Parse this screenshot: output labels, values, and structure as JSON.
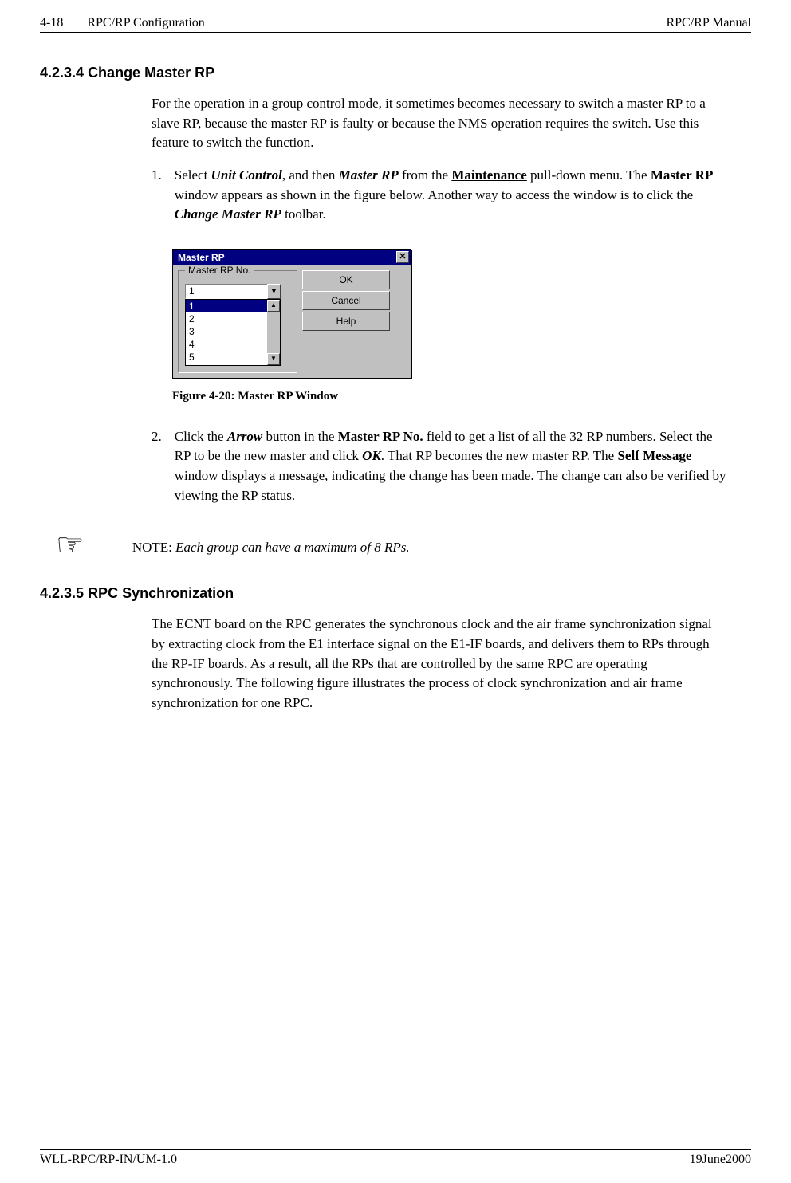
{
  "header": {
    "page_num": "4-18",
    "left_title": "RPC/RP Configuration",
    "right_title": "RPC/RP Manual"
  },
  "section1": {
    "number": "4.2.3.4",
    "title": "Change Master RP",
    "intro": "For the operation in a group control mode, it sometimes becomes necessary to switch a master RP to a slave RP, because the master RP is faulty or because the NMS operation requires the switch.  Use this feature to switch the function.",
    "step1": {
      "num": "1.",
      "p1_a": "Select ",
      "p1_b_ib": "Unit Control",
      "p1_c": ", and then ",
      "p1_d_ib": "Master RP",
      "p1_e": " from the ",
      "p1_f_ub": "Maintenance",
      "p1_g": " pull-down menu.  The ",
      "p1_h_b": "Master RP",
      "p1_i": " window appears as shown in the figure below.  Another way to access the window is to click the ",
      "p1_j_ib": "Change Master RP",
      "p1_k": " toolbar."
    },
    "step2": {
      "num": "2.",
      "p1_a": "Click the ",
      "p1_b_ib": "Arrow",
      "p1_c": " button in the ",
      "p1_d_b": "Master RP No.",
      "p1_e": " field to get a list of all the 32 RP numbers.  Select the RP to be the new master and click ",
      "p1_f_ib": "OK",
      "p1_g": ".  That RP becomes the new master RP.  The ",
      "p1_h_b": "Self Message",
      "p1_i": " window displays a message, indicating the change has been made.  The change can also be verified by viewing the RP status."
    }
  },
  "dialog": {
    "title": "Master RP",
    "group_label": "Master RP No.",
    "selected": "1",
    "items": [
      "1",
      "2",
      "3",
      "4",
      "5"
    ],
    "buttons": {
      "ok": "OK",
      "cancel": "Cancel",
      "help": "Help"
    }
  },
  "figure_caption": "Figure 4-20: Master RP Window",
  "note": {
    "label": "NOTE: ",
    "text_italic": "Each group can have a maximum of 8 RPs."
  },
  "section2": {
    "number": "4.2.3.5",
    "title": "RPC Synchronization",
    "body": "The ECNT board on the RPC generates the synchronous clock and the air frame synchronization signal by extracting clock from the E1 interface signal on the E1-IF boards, and delivers them to RPs through the RP-IF boards.  As a result, all the RPs that are controlled by the same RPC are operating synchronously.  The following figure illustrates the process of clock synchronization and air frame synchronization for one RPC."
  },
  "footer": {
    "left": "WLL-RPC/RP-IN/UM-1.0",
    "right": "19June2000"
  }
}
